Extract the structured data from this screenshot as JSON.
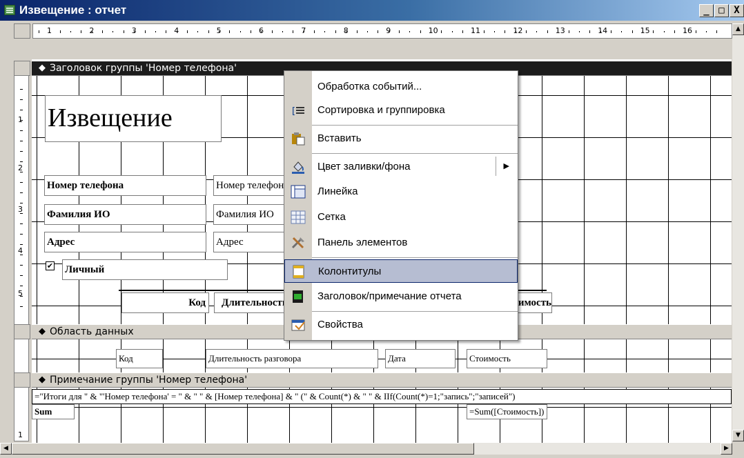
{
  "window": {
    "title": "Извещение : отчет"
  },
  "title_buttons": {
    "minimize": "_",
    "maximize": "□",
    "close": "X"
  },
  "ruler": {
    "h_labels": [
      "1",
      "2",
      "3",
      "4",
      "5",
      "6",
      "7",
      "8",
      "9",
      "10",
      "11",
      "12",
      "13",
      "14",
      "15",
      "16"
    ],
    "v_labels": [
      "1",
      "2",
      "3",
      "4",
      "5",
      "1"
    ]
  },
  "bands": {
    "group_header": "Заголовок группы 'Номер телефона'",
    "detail": "Область данных",
    "group_footer": "Примечание группы 'Номер телефона'"
  },
  "header_controls": {
    "title": "Извещение",
    "phone_label": "Номер телефона",
    "phone_field": "Номер телефона",
    "name_label": "Фамилия ИО",
    "name_field": "Фамилия ИО",
    "address_label": "Адрес",
    "address_field": "Адрес",
    "personal_label": "Личный",
    "col_code": "Код",
    "col_duration": "Длительность разговора",
    "col_cost": "Стоимость"
  },
  "detail_controls": {
    "code": "Код",
    "duration": "Длительность разговора",
    "date": "Дата",
    "cost": "Стоимость"
  },
  "footer_controls": {
    "summary_expr": "=\"Итоги для \" & \"'Номер телефона' = \" & \" \" & [Номер телефона] & \" (\" & Count(*) & \" \" & IIf(Count(*)=1;\"запись\";\"записей\")",
    "sum_label": "Sum",
    "sum_expr": "=Sum([Стоимость])"
  },
  "context_menu": {
    "items": [
      {
        "label": "Обработка событий...",
        "icon": "none"
      },
      {
        "label": "Сортировка и группировка",
        "icon": "sorting-icon"
      },
      {
        "label": "Вставить",
        "icon": "paste-icon"
      },
      {
        "label": "Цвет заливки/фона",
        "icon": "fill-color-icon"
      },
      {
        "label": "Линейка",
        "icon": "ruler-icon"
      },
      {
        "label": "Сетка",
        "icon": "grid-icon"
      },
      {
        "label": "Панель элементов",
        "icon": "toolbox-icon"
      },
      {
        "label": "Колонтитулы",
        "icon": "page-header-footer-icon"
      },
      {
        "label": "Заголовок/примечание отчета",
        "icon": "report-header-footer-icon"
      },
      {
        "label": "Свойства",
        "icon": "properties-icon"
      }
    ],
    "highlighted": "Колонтитулы",
    "submenu_indicator": "▶"
  },
  "checkbox": {
    "checked": true,
    "mark": "✔"
  },
  "colors": {
    "title_start": "#0a246a",
    "menu_highlight": "#b6bdd2",
    "selected_band": "#1c1c1c"
  }
}
